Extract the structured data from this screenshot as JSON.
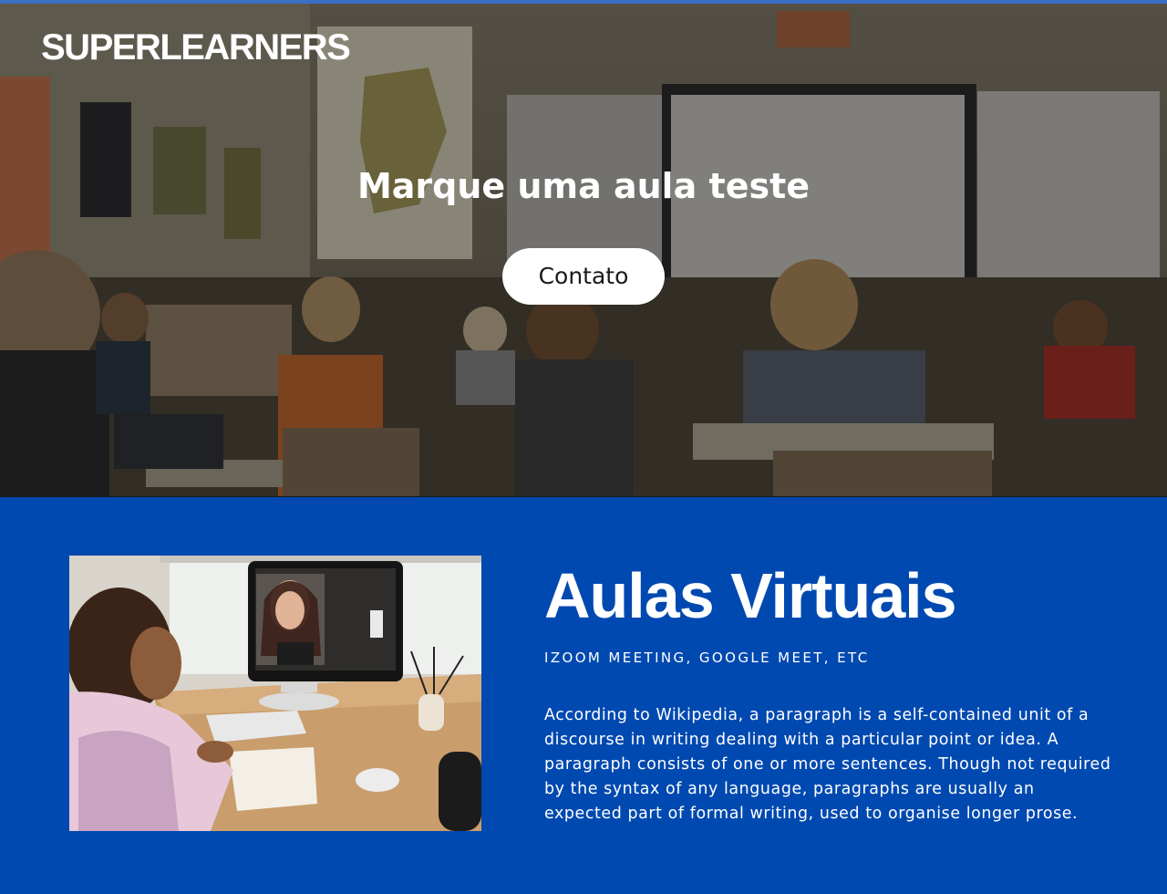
{
  "brand": {
    "name": "SUPERLEARNERS"
  },
  "hero": {
    "title": "Marque uma aula teste",
    "cta_label": "Contato"
  },
  "virtual": {
    "title": "Aulas Virtuais",
    "subtitle": "IZOOM MEETING, GOOGLE MEET, ETC",
    "body": "According to Wikipedia, a paragraph is a self-contained unit of a discourse in writing dealing with a particular point or idea. A paragraph consists of one or more sentences. Though not required by the syntax of any language, paragraphs are usually an expected part of formal writing, used to organise longer prose."
  },
  "colors": {
    "section_background": "#0049b0",
    "top_border": "#3a6fc4",
    "text_on_dark": "#ffffff",
    "button_background": "#ffffff"
  }
}
